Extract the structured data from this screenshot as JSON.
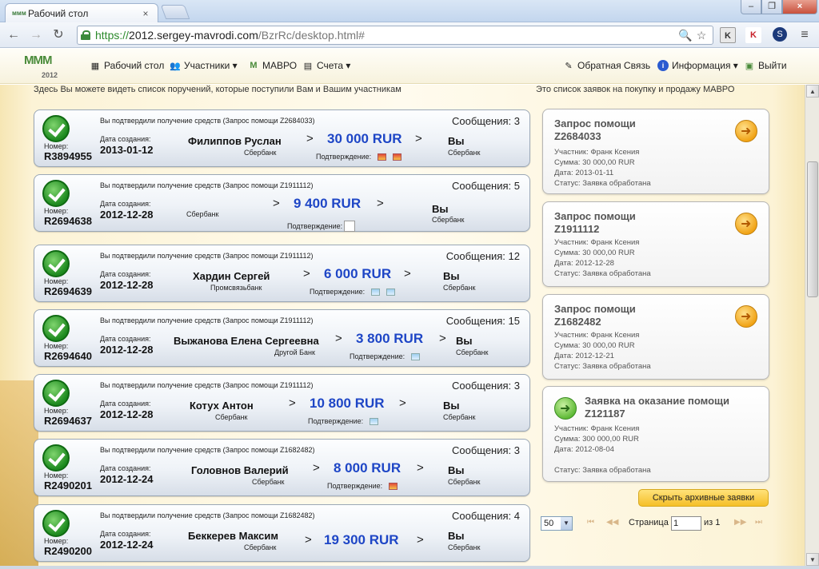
{
  "browser": {
    "tab_title": "Рабочий стол",
    "tab_favicon": "ммм-favicon",
    "url_scheme": "https://",
    "url_host": "2012.sergey-mavrodi.com",
    "url_path": "/BzrRc/desktop.html#",
    "close_glyph": "×",
    "min_glyph": "–",
    "max_glyph": "❐",
    "win_close_glyph": "×",
    "back_glyph": "←",
    "forward_glyph": "→",
    "reload_glyph": "↻",
    "zoom_glyph": "🔍",
    "star_glyph": "☆",
    "menu_glyph": "≡",
    "ext1_label": "K",
    "ext2_label": "K",
    "ext3_label": "S"
  },
  "site": {
    "logo_text": "МММ",
    "logo_year": "2012",
    "nav_left": [
      {
        "label": "Рабочий стол",
        "icon": "▦"
      },
      {
        "label": "Участники ▾",
        "icon": "👥"
      },
      {
        "label": "МАВРО",
        "icon": "M"
      },
      {
        "label": "Счета ▾",
        "icon": "▤"
      }
    ],
    "nav_right": [
      {
        "label": "Обратная Связь",
        "icon": "✎"
      },
      {
        "label": "Информация ▾",
        "icon": "i"
      },
      {
        "label": "Выйти",
        "icon": "▣"
      }
    ],
    "intro_left": "Здесь Вы можете видеть список поручений, которые поступили Вам и Вашим участникам",
    "intro_right": "Это список заявок на покупку и продажу МАВРО"
  },
  "orders": [
    {
      "desc": "Вы подтвердили получение средств (Запрос помощи Z2684033)",
      "messages": "Сообщения: 3",
      "number_label": "Номер:",
      "number": "R3894955",
      "date_label": "Дата создания:",
      "date": "2013-01-12",
      "sender": "Филиппов Руслан",
      "sender_bank": "Сбербанк",
      "amount": "30 000 RUR",
      "confirm_label": "Подтверждение:",
      "arrow": ">",
      "you": "Вы",
      "you_bank": "Сбербанк"
    },
    {
      "desc": "Вы подтвердили получение средств (Запрос помощи Z1911112)",
      "messages": "Сообщения: 5",
      "number_label": "Номер:",
      "number": "R2694638",
      "date_label": "Дата создания:",
      "date": "2012-12-28",
      "sender": "",
      "sender_bank": "Сбербанк",
      "amount": "9 400 RUR",
      "confirm_label": "Подтверждение:",
      "arrow": ">",
      "you": "Вы",
      "you_bank": "Сбербанк"
    },
    {
      "desc": "Вы подтвердили получение средств (Запрос помощи Z1911112)",
      "messages": "Сообщения: 12",
      "number_label": "Номер:",
      "number": "R2694639",
      "date_label": "Дата создания:",
      "date": "2012-12-28",
      "sender": "Хардин Сергей",
      "sender_bank": "Промсвязьбанк",
      "amount": "6 000 RUR",
      "confirm_label": "Подтверждение:",
      "arrow": ">",
      "you": "Вы",
      "you_bank": "Сбербанк"
    },
    {
      "desc": "Вы подтвердили получение средств (Запрос помощи Z1911112)",
      "messages": "Сообщения: 15",
      "number_label": "Номер:",
      "number": "R2694640",
      "date_label": "Дата создания:",
      "date": "2012-12-28",
      "sender": "Выжанова Елена Сергеевна",
      "sender_bank": "Другой Банк",
      "amount": "3 800 RUR",
      "confirm_label": "Подтверждение:",
      "arrow": ">",
      "you": "Вы",
      "you_bank": "Сбербанк"
    },
    {
      "desc": "Вы подтвердили получение средств (Запрос помощи Z1911112)",
      "messages": "Сообщения: 3",
      "number_label": "Номер:",
      "number": "R2694637",
      "date_label": "Дата создания:",
      "date": "2012-12-28",
      "sender": "Котух Антон",
      "sender_bank": "Сбербанк",
      "amount": "10 800 RUR",
      "confirm_label": "Подтверждение:",
      "arrow": ">",
      "you": "Вы",
      "you_bank": "Сбербанк"
    },
    {
      "desc": "Вы подтвердили получение средств (Запрос помощи Z1682482)",
      "messages": "Сообщения: 3",
      "number_label": "Номер:",
      "number": "R2490201",
      "date_label": "Дата создания:",
      "date": "2012-12-24",
      "sender": "Головнов Валерий",
      "sender_bank": "Сбербанк",
      "amount": "8 000 RUR",
      "confirm_label": "Подтверждение:",
      "arrow": ">",
      "you": "Вы",
      "you_bank": "Сбербанк"
    },
    {
      "desc": "Вы подтвердили получение средств (Запрос помощи Z1682482)",
      "messages": "Сообщения: 4",
      "number_label": "Номер:",
      "number": "R2490200",
      "date_label": "Дата создания:",
      "date": "2012-12-24",
      "sender": "Беккерев Максим",
      "sender_bank": "Сбербанк",
      "amount": "19 300 RUR",
      "confirm_label": "",
      "arrow": ">",
      "you": "Вы",
      "you_bank": "Сбербанк"
    }
  ],
  "requests": [
    {
      "title": "Запрос помощи",
      "id": "Z2684033",
      "participant": "Участник: Франк Ксения",
      "sum": "Сумма: 30 000,00 RUR",
      "date": "Дата: 2013-01-11",
      "status": "Статус: Заявка обработана"
    },
    {
      "title": "Запрос помощи",
      "id": "Z1911112",
      "participant": "Участник: Франк Ксения",
      "sum": "Сумма: 30 000,00 RUR",
      "date": "Дата: 2012-12-28",
      "status": "Статус: Заявка обработана"
    },
    {
      "title": "Запрос помощи",
      "id": "Z1682482",
      "participant": "Участник: Франк Ксения",
      "sum": "Сумма: 30 000,00 RUR",
      "date": "Дата: 2012-12-21",
      "status": "Статус: Заявка обработана"
    },
    {
      "title": "Заявка на оказание помощи",
      "id": "Z121187",
      "participant": "Участник: Франк Ксения",
      "sum": "Сумма: 300 000,00 RUR",
      "date": "Дата: 2012-08-04",
      "status": "Статус: Заявка обработана"
    }
  ],
  "hide_archive_label": "Скрыть архивные заявки",
  "pager": {
    "per_page": "50",
    "dropdown_glyph": "▼",
    "first_glyph": "⏮",
    "prev_glyph": "◀◀",
    "next_glyph": "▶▶",
    "last_glyph": "⏭",
    "page_label": "Страница",
    "page_value": "1",
    "of_label": "из 1"
  },
  "scroll": {
    "up_glyph": "▲",
    "down_glyph": "▼"
  }
}
